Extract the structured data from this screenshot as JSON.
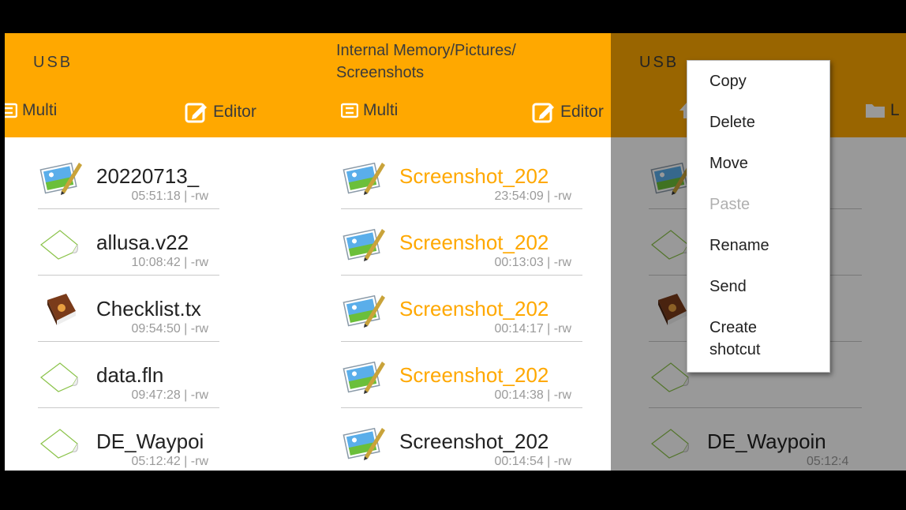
{
  "panels": [
    {
      "path": "USB",
      "toolbar": {
        "multi": "Multi",
        "editor": "Editor"
      },
      "files": [
        {
          "name": "20220713_",
          "meta": "05:51:18 | -rw",
          "icon": "image-icon",
          "highlight": false
        },
        {
          "name": "allusa.v22",
          "meta": "10:08:42 | -rw",
          "icon": "blank-file-icon",
          "highlight": false
        },
        {
          "name": "Checklist.tx",
          "meta": "09:54:50 | -rw",
          "icon": "book-icon",
          "highlight": false
        },
        {
          "name": "data.fln",
          "meta": "09:47:28 | -rw",
          "icon": "blank-file-icon",
          "highlight": false
        },
        {
          "name": "DE_Waypoi",
          "meta": "05:12:42 | -rw",
          "icon": "blank-file-icon",
          "highlight": false
        }
      ]
    },
    {
      "path": "Internal Memory/Pictures/\nScreenshots",
      "toolbar": {
        "multi": "Multi",
        "editor": "Editor"
      },
      "files": [
        {
          "name": "Screenshot_202",
          "meta": "23:54:09 | -rw",
          "icon": "image-icon",
          "highlight": true
        },
        {
          "name": "Screenshot_202",
          "meta": "00:13:03 | -rw",
          "icon": "image-icon",
          "highlight": true
        },
        {
          "name": "Screenshot_202",
          "meta": "00:14:17 | -rw",
          "icon": "image-icon",
          "highlight": true
        },
        {
          "name": "Screenshot_202",
          "meta": "00:14:38 | -rw",
          "icon": "image-icon",
          "highlight": true
        },
        {
          "name": "Screenshot_202",
          "meta": "00:14:54 | -rw",
          "icon": "image-icon",
          "highlight": false
        }
      ]
    },
    {
      "path": "USB",
      "toolbar": {
        "partial": "L"
      },
      "files": [
        {
          "name": "",
          "meta": "",
          "icon": "image-icon",
          "highlight": false
        },
        {
          "name": "",
          "meta": "",
          "icon": "blank-file-icon",
          "highlight": false
        },
        {
          "name": "",
          "meta": "",
          "icon": "book-icon",
          "highlight": false
        },
        {
          "name": "",
          "meta": "",
          "icon": "blank-file-icon",
          "highlight": false
        },
        {
          "name": "DE_Waypoin",
          "meta": "05:12:4",
          "icon": "blank-file-icon",
          "highlight": false
        }
      ]
    }
  ],
  "context_menu": {
    "items": [
      {
        "label": "Copy",
        "enabled": true
      },
      {
        "label": "Delete",
        "enabled": true
      },
      {
        "label": "Move",
        "enabled": true
      },
      {
        "label": "Paste",
        "enabled": false
      },
      {
        "label": "Rename",
        "enabled": true
      },
      {
        "label": "Send",
        "enabled": true
      },
      {
        "label": "Create\nshotcut",
        "enabled": true
      }
    ]
  },
  "colors": {
    "accent": "#FFA800",
    "text": "#222222",
    "meta": "#9a9a9a"
  }
}
